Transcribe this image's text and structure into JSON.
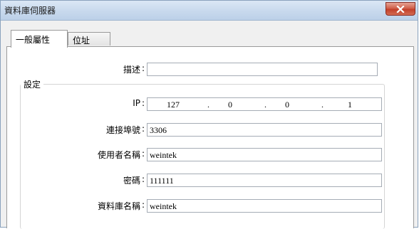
{
  "window": {
    "title": "資料庫伺服器"
  },
  "tabs": [
    {
      "label": "一般屬性",
      "active": true
    },
    {
      "label": "位址",
      "active": false
    }
  ],
  "form": {
    "description": {
      "label": "描述",
      "value": ""
    },
    "group_title": "設定",
    "ip": {
      "label": "IP",
      "octets": [
        "127",
        "0",
        "0",
        "1"
      ]
    },
    "port": {
      "label": "連接埠號",
      "value": "3306"
    },
    "username": {
      "label": "使用者名稱",
      "value": "weintek"
    },
    "password": {
      "label": "密碼",
      "value": "111111"
    },
    "database": {
      "label": "資料庫名稱",
      "value": "weintek"
    }
  },
  "colon": ":",
  "icons": {
    "close": "close-icon"
  },
  "colors": {
    "titlebar": "#c8d9ed",
    "close": "#c2402a"
  }
}
